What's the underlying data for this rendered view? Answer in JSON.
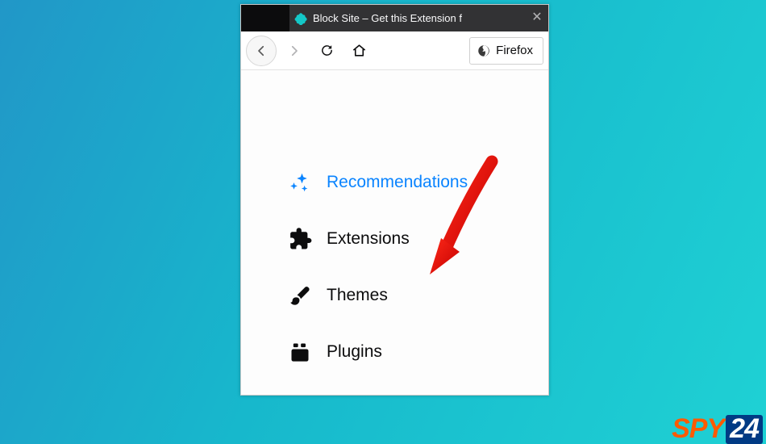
{
  "tab": {
    "title": "Block Site – Get this Extension f"
  },
  "toolbar": {
    "firefox_label": "Firefox"
  },
  "sidebar": {
    "items": [
      {
        "label": "Recommendations"
      },
      {
        "label": "Extensions"
      },
      {
        "label": "Themes"
      },
      {
        "label": "Plugins"
      }
    ]
  },
  "watermark": {
    "part1": "SPY",
    "part2": "24"
  }
}
